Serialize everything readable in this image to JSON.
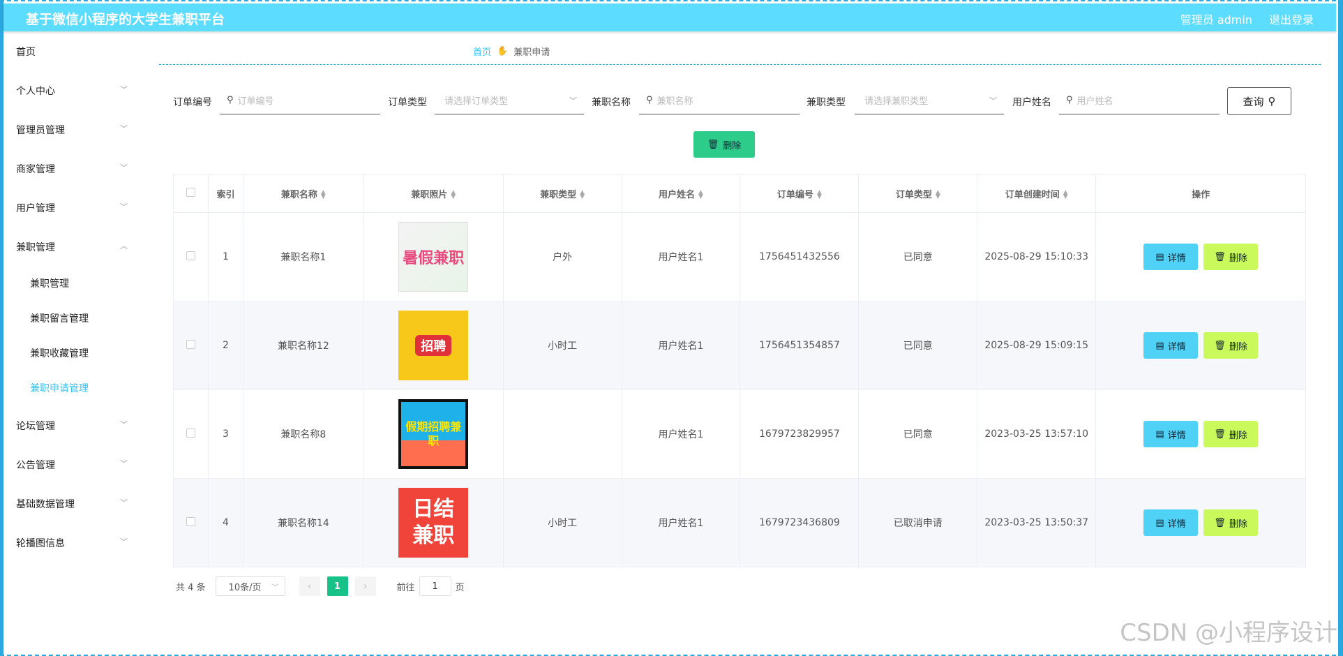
{
  "header": {
    "title": "基于微信小程序的大学生兼职平台",
    "user": "管理员 admin",
    "logout": "退出登录"
  },
  "sidebar": {
    "items": [
      {
        "label": "首页",
        "expandable": false
      },
      {
        "label": "个人中心",
        "expandable": true
      },
      {
        "label": "管理员管理",
        "expandable": true
      },
      {
        "label": "商家管理",
        "expandable": true
      },
      {
        "label": "用户管理",
        "expandable": true
      },
      {
        "label": "兼职管理",
        "expandable": true,
        "expanded": true
      },
      {
        "label": "论坛管理",
        "expandable": true
      },
      {
        "label": "公告管理",
        "expandable": true
      },
      {
        "label": "基础数据管理",
        "expandable": true
      },
      {
        "label": "轮播图信息",
        "expandable": true
      }
    ],
    "submenu": [
      {
        "label": "兼职管理"
      },
      {
        "label": "兼职留言管理"
      },
      {
        "label": "兼职收藏管理"
      },
      {
        "label": "兼职申请管理",
        "active": true
      }
    ]
  },
  "breadcrumb": {
    "home": "首页",
    "current": "兼职申请"
  },
  "search": {
    "order_no_label": "订单编号",
    "order_no_placeholder": "订单编号",
    "order_type_label": "订单类型",
    "order_type_placeholder": "请选择订单类型",
    "job_name_label": "兼职名称",
    "job_name_placeholder": "兼职名称",
    "job_type_label": "兼职类型",
    "job_type_placeholder": "请选择兼职类型",
    "user_name_label": "用户姓名",
    "user_name_placeholder": "用户姓名",
    "query_button": "查询"
  },
  "actions": {
    "bulk_delete": "删除",
    "detail": "详情",
    "delete": "删除"
  },
  "table": {
    "headers": [
      "索引",
      "兼职名称",
      "兼职照片",
      "兼职类型",
      "用户姓名",
      "订单编号",
      "订单类型",
      "订单创建时间",
      "操作"
    ],
    "rows": [
      {
        "index": "1",
        "job_name": "兼职名称1",
        "photo": "暑假兼职",
        "job_type": "户外",
        "user_name": "用户姓名1",
        "order_no": "1756451432556",
        "order_type": "已同意",
        "created": "2025-08-29 15:10:33"
      },
      {
        "index": "2",
        "job_name": "兼职名称12",
        "photo": "招聘",
        "job_type": "小时工",
        "user_name": "用户姓名1",
        "order_no": "1756451354857",
        "order_type": "已同意",
        "created": "2025-08-29 15:09:15"
      },
      {
        "index": "3",
        "job_name": "兼职名称8",
        "photo": "假期招聘兼职",
        "job_type": "",
        "user_name": "用户姓名1",
        "order_no": "1679723829957",
        "order_type": "已同意",
        "created": "2023-03-25 13:57:10"
      },
      {
        "index": "4",
        "job_name": "兼职名称14",
        "photo": "日结兼职",
        "job_type": "小时工",
        "user_name": "用户姓名1",
        "order_no": "1679723436809",
        "order_type": "已取消申请",
        "created": "2023-03-25 13:50:37"
      }
    ]
  },
  "pagination": {
    "total": "共 4 条",
    "page_size": "10条/页",
    "current_page": "1",
    "goto_label": "前往",
    "goto_value": "1",
    "goto_suffix": "页"
  },
  "watermark": "CSDN @小程序设计",
  "colors": {
    "header": "#5cdcff",
    "active_menu": "#38c3f5",
    "delete_green": "#2dcc8b",
    "detail_blue": "#4fd2f5",
    "row_delete_lime": "#c9f95a",
    "pager_current": "#17c289"
  }
}
